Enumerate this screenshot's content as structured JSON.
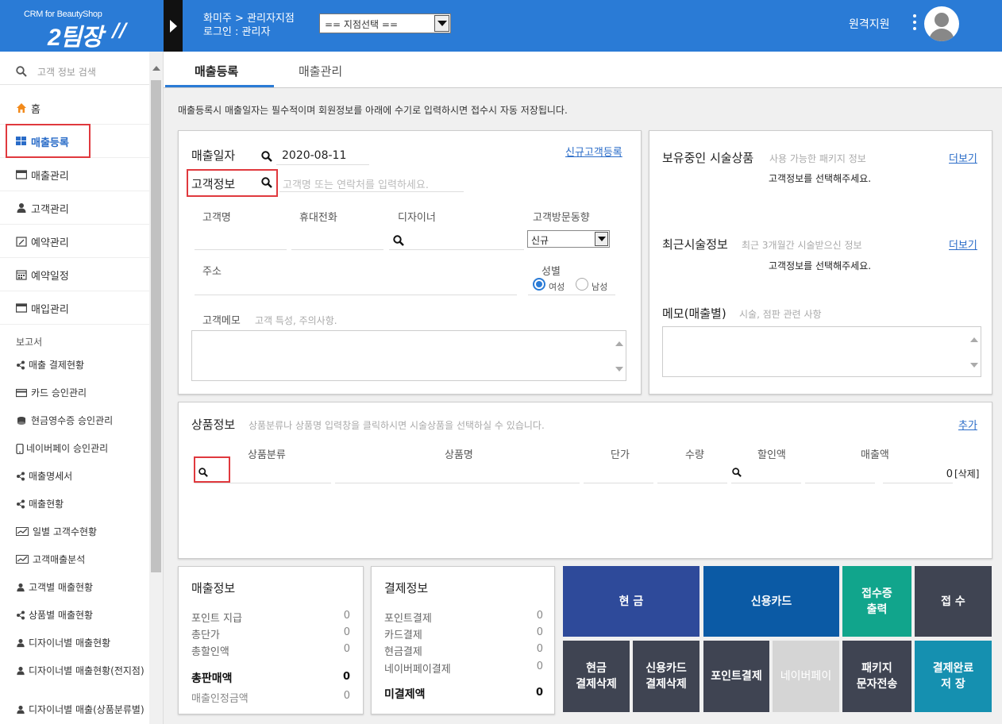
{
  "header": {
    "logo_small": "CRM for BeautyShop",
    "logo_big": "2팀장",
    "crumb_line1": "화미주 > 관리자지점",
    "crumb_line2": "로그인 : 관리자",
    "branch_select": "== 지점선택 ==",
    "remote_support": "원격지원"
  },
  "sidebar": {
    "search_placeholder": "고객 정보 검색",
    "items": [
      {
        "label": "홈",
        "icon": "home-icon"
      },
      {
        "label": "매출등록",
        "icon": "grid-icon"
      },
      {
        "label": "매출관리",
        "icon": "window-icon"
      },
      {
        "label": "고객관리",
        "icon": "user-icon"
      },
      {
        "label": "예약관리",
        "icon": "edit-calendar-icon"
      },
      {
        "label": "예약일정",
        "icon": "calendar-icon"
      },
      {
        "label": "매입관리",
        "icon": "window-icon"
      }
    ],
    "report_section": "보고서",
    "reports": [
      {
        "label": "매출 결제현황",
        "icon": "share-icon"
      },
      {
        "label": "카드 승인관리",
        "icon": "card-icon"
      },
      {
        "label": "현금영수증 승인관리",
        "icon": "coins-icon"
      },
      {
        "label": "네이버페이 승인관리",
        "icon": "phone-icon"
      },
      {
        "label": "매출명세서",
        "icon": "share-icon"
      },
      {
        "label": "매출현황",
        "icon": "share-icon"
      },
      {
        "label": "일별 고객수현황",
        "icon": "chart-icon"
      },
      {
        "label": "고객매출분석",
        "icon": "chart-icon"
      },
      {
        "label": "고객별 매출현황",
        "icon": "user-icon"
      },
      {
        "label": "상품별 매출현황",
        "icon": "share-icon"
      },
      {
        "label": "디자이너별 매출현황",
        "icon": "user-icon"
      },
      {
        "label": "디자이너별 매출현황(전지점)",
        "icon": "user-icon"
      },
      {
        "label": "디자이너별 매출(상품분류별)",
        "icon": "user-icon"
      }
    ]
  },
  "tabs": [
    "매출등록",
    "매출관리"
  ],
  "notice": "매출등록시 매출일자는 필수적이며 회원정보를 아래에 수기로 입력하시면 접수시 자동 저장됩니다.",
  "customer": {
    "sale_date_label": "매출일자",
    "sale_date": "2020-08-11",
    "new_customer_link": "신규고객등록",
    "info_label": "고객정보",
    "search_placeholder": "고객명 또는 연락처를 입력하세요.",
    "name_label": "고객명",
    "phone_label": "휴대전화",
    "designer_label": "디자이너",
    "visit_label": "고객방문동향",
    "visit_value": "신규",
    "address_label": "주소",
    "gender_label": "성별",
    "gender_female": "여성",
    "gender_male": "남성",
    "memo_label": "고객메모",
    "memo_placeholder": "고객 특성, 주의사항."
  },
  "right_panel": {
    "packages_title": "보유중인 시술상품",
    "packages_sub": "사용 가능한 패키지 정보",
    "packages_more": "더보기",
    "packages_msg": "고객정보를 선택해주세요.",
    "recent_title": "최근시술정보",
    "recent_sub": "최근 3개월간 시술받으신 정보",
    "recent_more": "더보기",
    "recent_msg": "고객정보를 선택해주세요.",
    "memo_title": "메모(매출별)",
    "memo_sub": "시술, 점판 관련 사항"
  },
  "product": {
    "title": "상품정보",
    "sub": "상품분류나 상품명 입력창을 클릭하시면 시술상품을 선택하실 수 있습니다.",
    "add": "추가",
    "col_category": "상품분류",
    "col_name": "상품명",
    "col_price": "단가",
    "col_qty": "수량",
    "col_discount": "할인액",
    "col_amount": "매출액",
    "amount": "0",
    "delete": "[삭제]"
  },
  "sales_info": {
    "title": "매출정보",
    "rows": [
      {
        "label": "포인트 지급",
        "value": "0"
      },
      {
        "label": "총단가",
        "value": "0"
      },
      {
        "label": "총할인액",
        "value": "0"
      }
    ],
    "total_label": "총판매액",
    "total_value": "0",
    "approved_label": "매출인정금액",
    "approved_value": "0"
  },
  "payment_info": {
    "title": "결제정보",
    "rows": [
      {
        "label": "포인트결제",
        "value": "0"
      },
      {
        "label": "카드결제",
        "value": "0"
      },
      {
        "label": "현금결제",
        "value": "0"
      },
      {
        "label": "네이버페이결제",
        "value": "0"
      }
    ],
    "unpaid_label": "미결제액",
    "unpaid_value": "0"
  },
  "buttons": {
    "cash": "현 금",
    "card": "신용카드",
    "receipt_l1": "접수증",
    "receipt_l2": "출력",
    "register": "접 수",
    "cash_del_l1": "현금",
    "cash_del_l2": "결제삭제",
    "card_del_l1": "신용카드",
    "card_del_l2": "결제삭제",
    "point_pay": "포인트결제",
    "naver_pay": "네이버페이",
    "pkg_sms_l1": "패키지",
    "pkg_sms_l2": "문자전송",
    "save_l1": "결제완료",
    "save_l2": "저 장"
  },
  "colors": {
    "header": "#2a7bd6",
    "cash": "#2e4a9a",
    "card": "#0b5aa5",
    "receipt": "#11a58c",
    "dark": "#3f4452",
    "naver": "#d5d5d5",
    "save": "#1590b0"
  }
}
